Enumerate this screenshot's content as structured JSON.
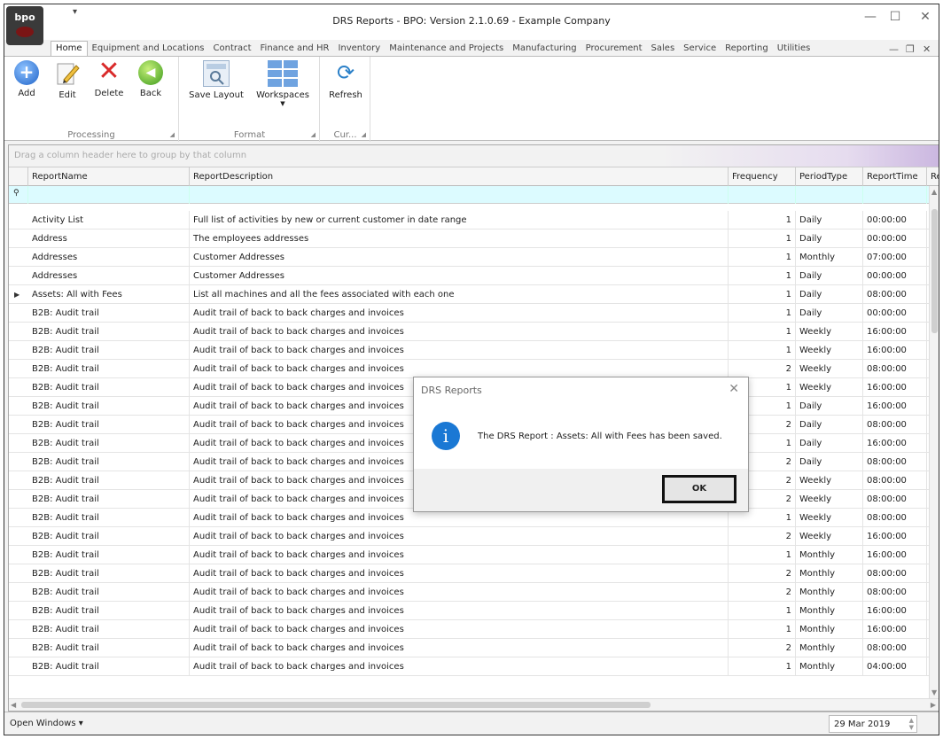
{
  "window": {
    "title": "DRS Reports - BPO: Version 2.1.0.69 - Example Company",
    "logo_text": "bpo",
    "qat_glyph": "▾",
    "minimize": "—",
    "maximize": "☐",
    "close": "✕"
  },
  "tabs": [
    "Home",
    "Equipment and Locations",
    "Contract",
    "Finance and HR",
    "Inventory",
    "Maintenance and Projects",
    "Manufacturing",
    "Procurement",
    "Sales",
    "Service",
    "Reporting",
    "Utilities"
  ],
  "mdi": {
    "minimize": "—",
    "restore": "❐",
    "close": "✕"
  },
  "ribbon": {
    "processing": {
      "name": "Processing",
      "add": "Add",
      "edit": "Edit",
      "delete": "Delete",
      "back": "Back"
    },
    "format": {
      "name": "Format",
      "save_layout": "Save Layout",
      "workspaces": "Workspaces"
    },
    "current": {
      "name": "Cur...",
      "refresh": "Refresh"
    }
  },
  "grid": {
    "group_hint": "Drag a column header here to group by that column",
    "columns": [
      "ReportName",
      "ReportDescription",
      "Frequency",
      "PeriodType",
      "ReportTime",
      "Re"
    ],
    "current_row": 4,
    "rows": [
      [
        "Activity List",
        "Full list of activities by new or current customer in date range",
        "1",
        "Daily",
        "00:00:00"
      ],
      [
        "Address",
        "The employees addresses",
        "1",
        "Daily",
        "00:00:00"
      ],
      [
        "Addresses",
        "Customer Addresses",
        "1",
        "Monthly",
        "07:00:00"
      ],
      [
        "Addresses",
        "Customer Addresses",
        "1",
        "Daily",
        "00:00:00"
      ],
      [
        "Assets: All with Fees",
        "List all machines and all the fees associated with each one",
        "1",
        "Daily",
        "08:00:00"
      ],
      [
        "B2B: Audit trail",
        "Audit trail of back to back charges and invoices",
        "1",
        "Daily",
        "00:00:00"
      ],
      [
        "B2B: Audit trail",
        "Audit trail of back to back charges and invoices",
        "1",
        "Weekly",
        "16:00:00"
      ],
      [
        "B2B: Audit trail",
        "Audit trail of back to back charges and invoices",
        "1",
        "Weekly",
        "16:00:00"
      ],
      [
        "B2B: Audit trail",
        "Audit trail of back to back charges and invoices",
        "2",
        "Weekly",
        "08:00:00"
      ],
      [
        "B2B: Audit trail",
        "Audit trail of back to back charges and invoices",
        "1",
        "Weekly",
        "16:00:00"
      ],
      [
        "B2B: Audit trail",
        "Audit trail of back to back charges and invoices",
        "1",
        "Daily",
        "16:00:00"
      ],
      [
        "B2B: Audit trail",
        "Audit trail of back to back charges and invoices",
        "2",
        "Daily",
        "08:00:00"
      ],
      [
        "B2B: Audit trail",
        "Audit trail of back to back charges and invoices",
        "1",
        "Daily",
        "16:00:00"
      ],
      [
        "B2B: Audit trail",
        "Audit trail of back to back charges and invoices",
        "2",
        "Daily",
        "08:00:00"
      ],
      [
        "B2B: Audit trail",
        "Audit trail of back to back charges and invoices",
        "2",
        "Weekly",
        "08:00:00"
      ],
      [
        "B2B: Audit trail",
        "Audit trail of back to back charges and invoices",
        "2",
        "Weekly",
        "08:00:00"
      ],
      [
        "B2B: Audit trail",
        "Audit trail of back to back charges and invoices",
        "1",
        "Weekly",
        "08:00:00"
      ],
      [
        "B2B: Audit trail",
        "Audit trail of back to back charges and invoices",
        "2",
        "Weekly",
        "16:00:00"
      ],
      [
        "B2B: Audit trail",
        "Audit trail of back to back charges and invoices",
        "1",
        "Monthly",
        "16:00:00"
      ],
      [
        "B2B: Audit trail",
        "Audit trail of back to back charges and invoices",
        "2",
        "Monthly",
        "08:00:00"
      ],
      [
        "B2B: Audit trail",
        "Audit trail of back to back charges and invoices",
        "2",
        "Monthly",
        "08:00:00"
      ],
      [
        "B2B: Audit trail",
        "Audit trail of back to back charges and invoices",
        "1",
        "Monthly",
        "16:00:00"
      ],
      [
        "B2B: Audit trail",
        "Audit trail of back to back charges and invoices",
        "1",
        "Monthly",
        "16:00:00"
      ],
      [
        "B2B: Audit trail",
        "Audit trail of back to back charges and invoices",
        "2",
        "Monthly",
        "08:00:00"
      ],
      [
        "B2B: Audit trail",
        "Audit trail of back to back charges and invoices",
        "1",
        "Monthly",
        "04:00:00"
      ]
    ]
  },
  "status": {
    "open_windows": "Open Windows ▾",
    "date": "29 Mar 2019"
  },
  "dialog": {
    "title": "DRS Reports",
    "icon_glyph": "i",
    "message": "The DRS Report : Assets: All with Fees has been saved.",
    "ok": "OK"
  },
  "colors": {
    "filter_row": "#dcfbff",
    "info_icon": "#1a78d4",
    "delete_icon": "#d92a2a",
    "add_icon": "#1f63c8",
    "back_icon": "#3a9a1b"
  }
}
